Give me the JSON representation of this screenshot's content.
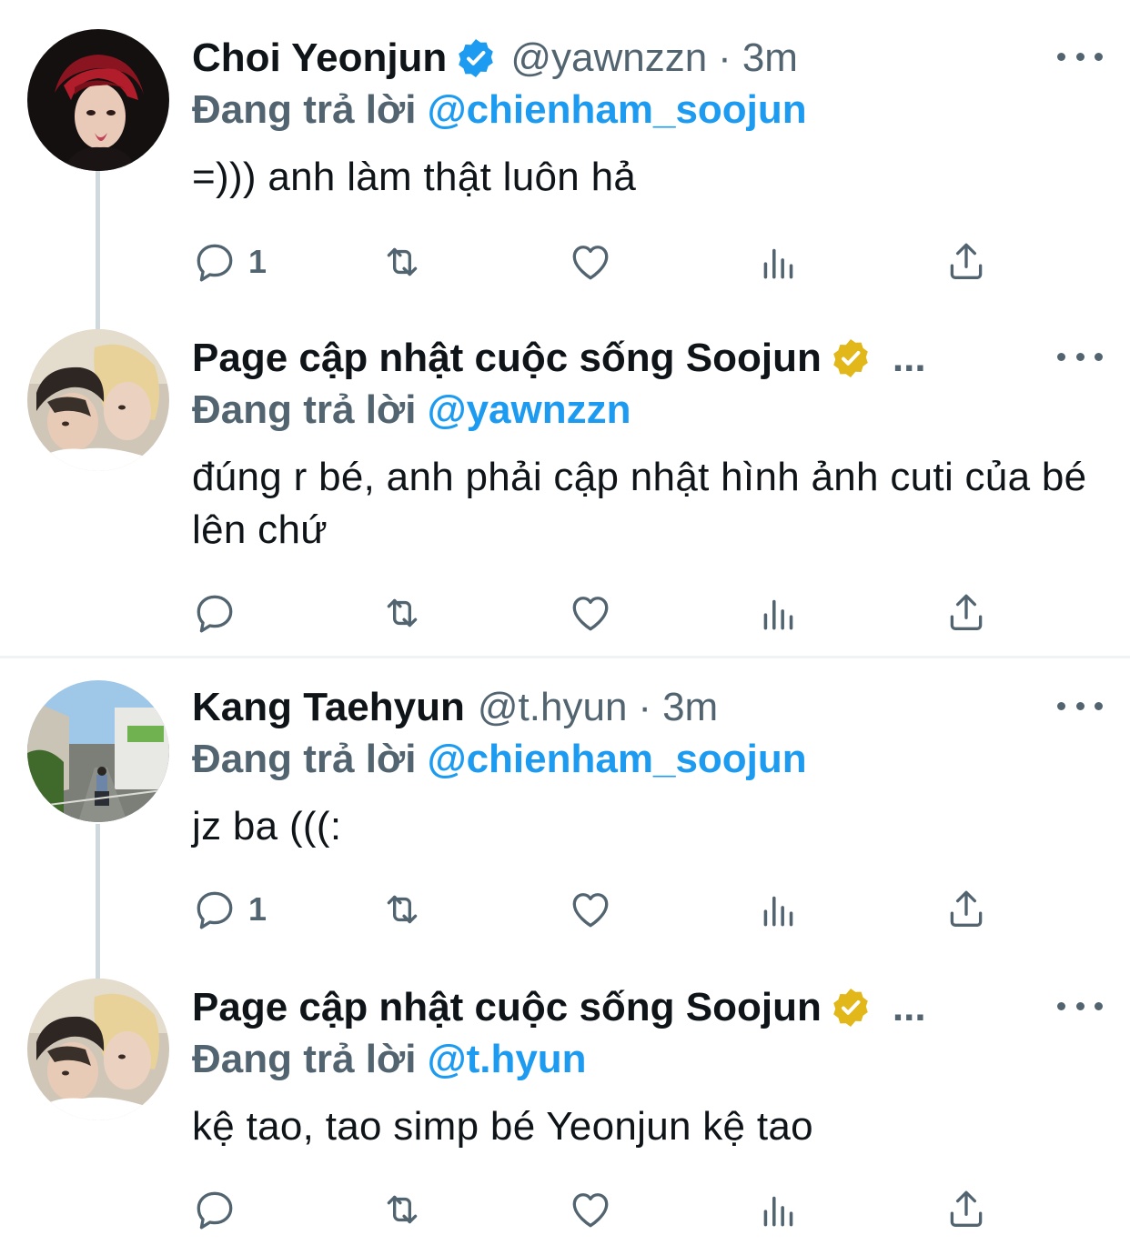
{
  "colors": {
    "text_primary": "#0f1419",
    "text_secondary": "#536471",
    "link_blue": "#1d9bf0",
    "verified_blue": "#1d9bf0",
    "verified_gold": "#e2b719",
    "thread_line": "#cfd9de"
  },
  "tweets": [
    {
      "display_name": "Choi Yeonjun",
      "verified": "blue-check-icon",
      "handle": "@yawnzzn",
      "separator": "·",
      "time": "3m",
      "replying_prefix": "Đang trả lời",
      "replying_to": "@chienham_soojun",
      "text": "=))) anh làm thật luôn hả",
      "reply_count": "1"
    },
    {
      "display_name": "Page cập nhật cuộc sống Soojun",
      "verified": "gold-check-icon",
      "truncation": "...",
      "replying_prefix": "Đang trả lời",
      "replying_to": "@yawnzzn",
      "text": "đúng r bé, anh phải cập nhật hình ảnh cuti của bé lên chứ",
      "reply_count": ""
    },
    {
      "display_name": "Kang Taehyun",
      "handle": "@t.hyun",
      "separator": "·",
      "time": "3m",
      "replying_prefix": "Đang trả lời",
      "replying_to": "@chienham_soojun",
      "text": "jz ba (((:",
      "reply_count": "1"
    },
    {
      "display_name": "Page cập nhật cuộc sống Soojun",
      "verified": "gold-check-icon",
      "truncation": "...",
      "replying_prefix": "Đang trả lời",
      "replying_to": "@t.hyun",
      "text": "kệ tao, tao simp bé Yeonjun kệ tao",
      "reply_count": ""
    }
  ]
}
